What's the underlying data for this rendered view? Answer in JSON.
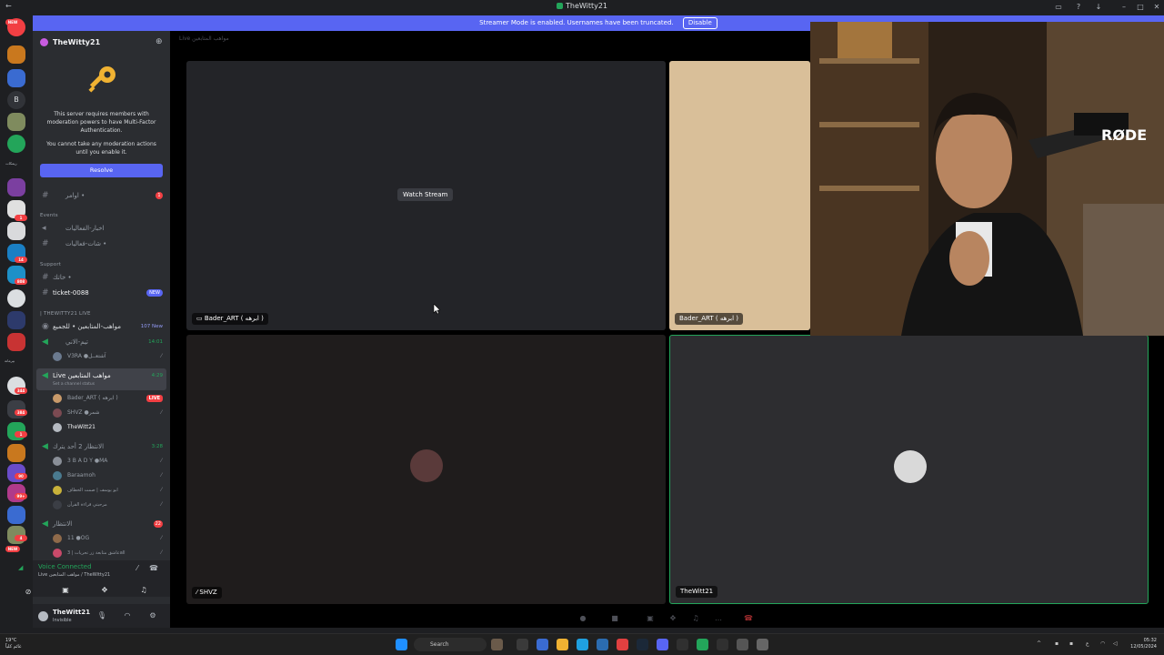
{
  "window": {
    "title": "TheWitty21"
  },
  "banner": {
    "text": "Streamer Mode is enabled. Usernames have been truncated.",
    "disable_label": "Disable"
  },
  "server": {
    "name": "TheWitty21",
    "mfa_text_1": "This server requires members with moderation powers to have Multi-Factor Authentication.",
    "mfa_text_2": "You cannot take any moderation actions until you enable it.",
    "resolve_label": "Resolve"
  },
  "rail": {
    "new_badge": "NEW",
    "letter_b": "B",
    "badges": [
      "1",
      "14",
      "808",
      "344",
      "384",
      "1",
      "90",
      "99+",
      "4",
      "NEW"
    ],
    "label_1": "ريمكات",
    "label_2": "بيرمانة"
  },
  "channels": {
    "first": {
      "name": "اوامر •",
      "count": "1"
    },
    "events_label": "Events",
    "events": [
      "اخبار-الفعاليات",
      "شات-فعاليات •"
    ],
    "support_label": "Support",
    "support_channel": "خاتك •",
    "ticket": {
      "name": "ticket-0088",
      "badge": "NEW"
    },
    "live_category": "| THEWITTY21 LIVE",
    "voice_main": {
      "name": "مواهب-المتابعين • للجميع",
      "count": "107 New"
    },
    "vc1": {
      "name": "تيم-الاني",
      "time": "14:01",
      "user": "V3RA ●آشتعــل"
    },
    "live_vc": {
      "name": "Live مواهب المتابعين",
      "time": "4:29",
      "status": "Set a channel status"
    },
    "live_users": [
      {
        "name": "Bader_ART ( ابرهه )",
        "badge": "LIVE"
      },
      {
        "name": "SHVZ ●شمر"
      },
      {
        "name": "TheWitt21"
      }
    ],
    "vc3": {
      "name": "الانتظار 2 أحد يترك",
      "time": "3:28"
    },
    "vc3_users": [
      "3 B A D Y ●MA",
      "Baraamoh",
      "ابو يوسف | صمت الخطاف",
      "مرحبتي قراءة القرآن"
    ],
    "vc4": {
      "name": "الانتظار",
      "count": "22"
    },
    "vc4_users": [
      "11 ●OG",
      "عاشق متابعة زر تحريات | 3all"
    ]
  },
  "voice_panel": {
    "title": "Voice Connected",
    "subtitle": "Live مواهب المتابعين / TheWitty21"
  },
  "user_panel": {
    "name": "TheWitt21",
    "status": "Invisible"
  },
  "stage": {
    "crumb": "Live مواهب المتابعين",
    "watch_label": "Watch Stream",
    "tiles": [
      {
        "name": "Bader_ART ( ابرهه )"
      },
      {
        "name": "Bader_ART ( ابرهه )"
      },
      {
        "name": "SHVZ"
      },
      {
        "name": "TheWitt21"
      }
    ]
  },
  "taskbar": {
    "weather_temp": "19°C",
    "weather_desc": "غائم كلياً",
    "search_label": "Search",
    "time": "05:32",
    "date": "12/05/2024",
    "lang": "ع"
  },
  "colors": {
    "blurple": "#5865f2",
    "green": "#23a55a",
    "red": "#f23f43",
    "sidebar": "#2b2d31",
    "stage_bg": "#000000"
  }
}
